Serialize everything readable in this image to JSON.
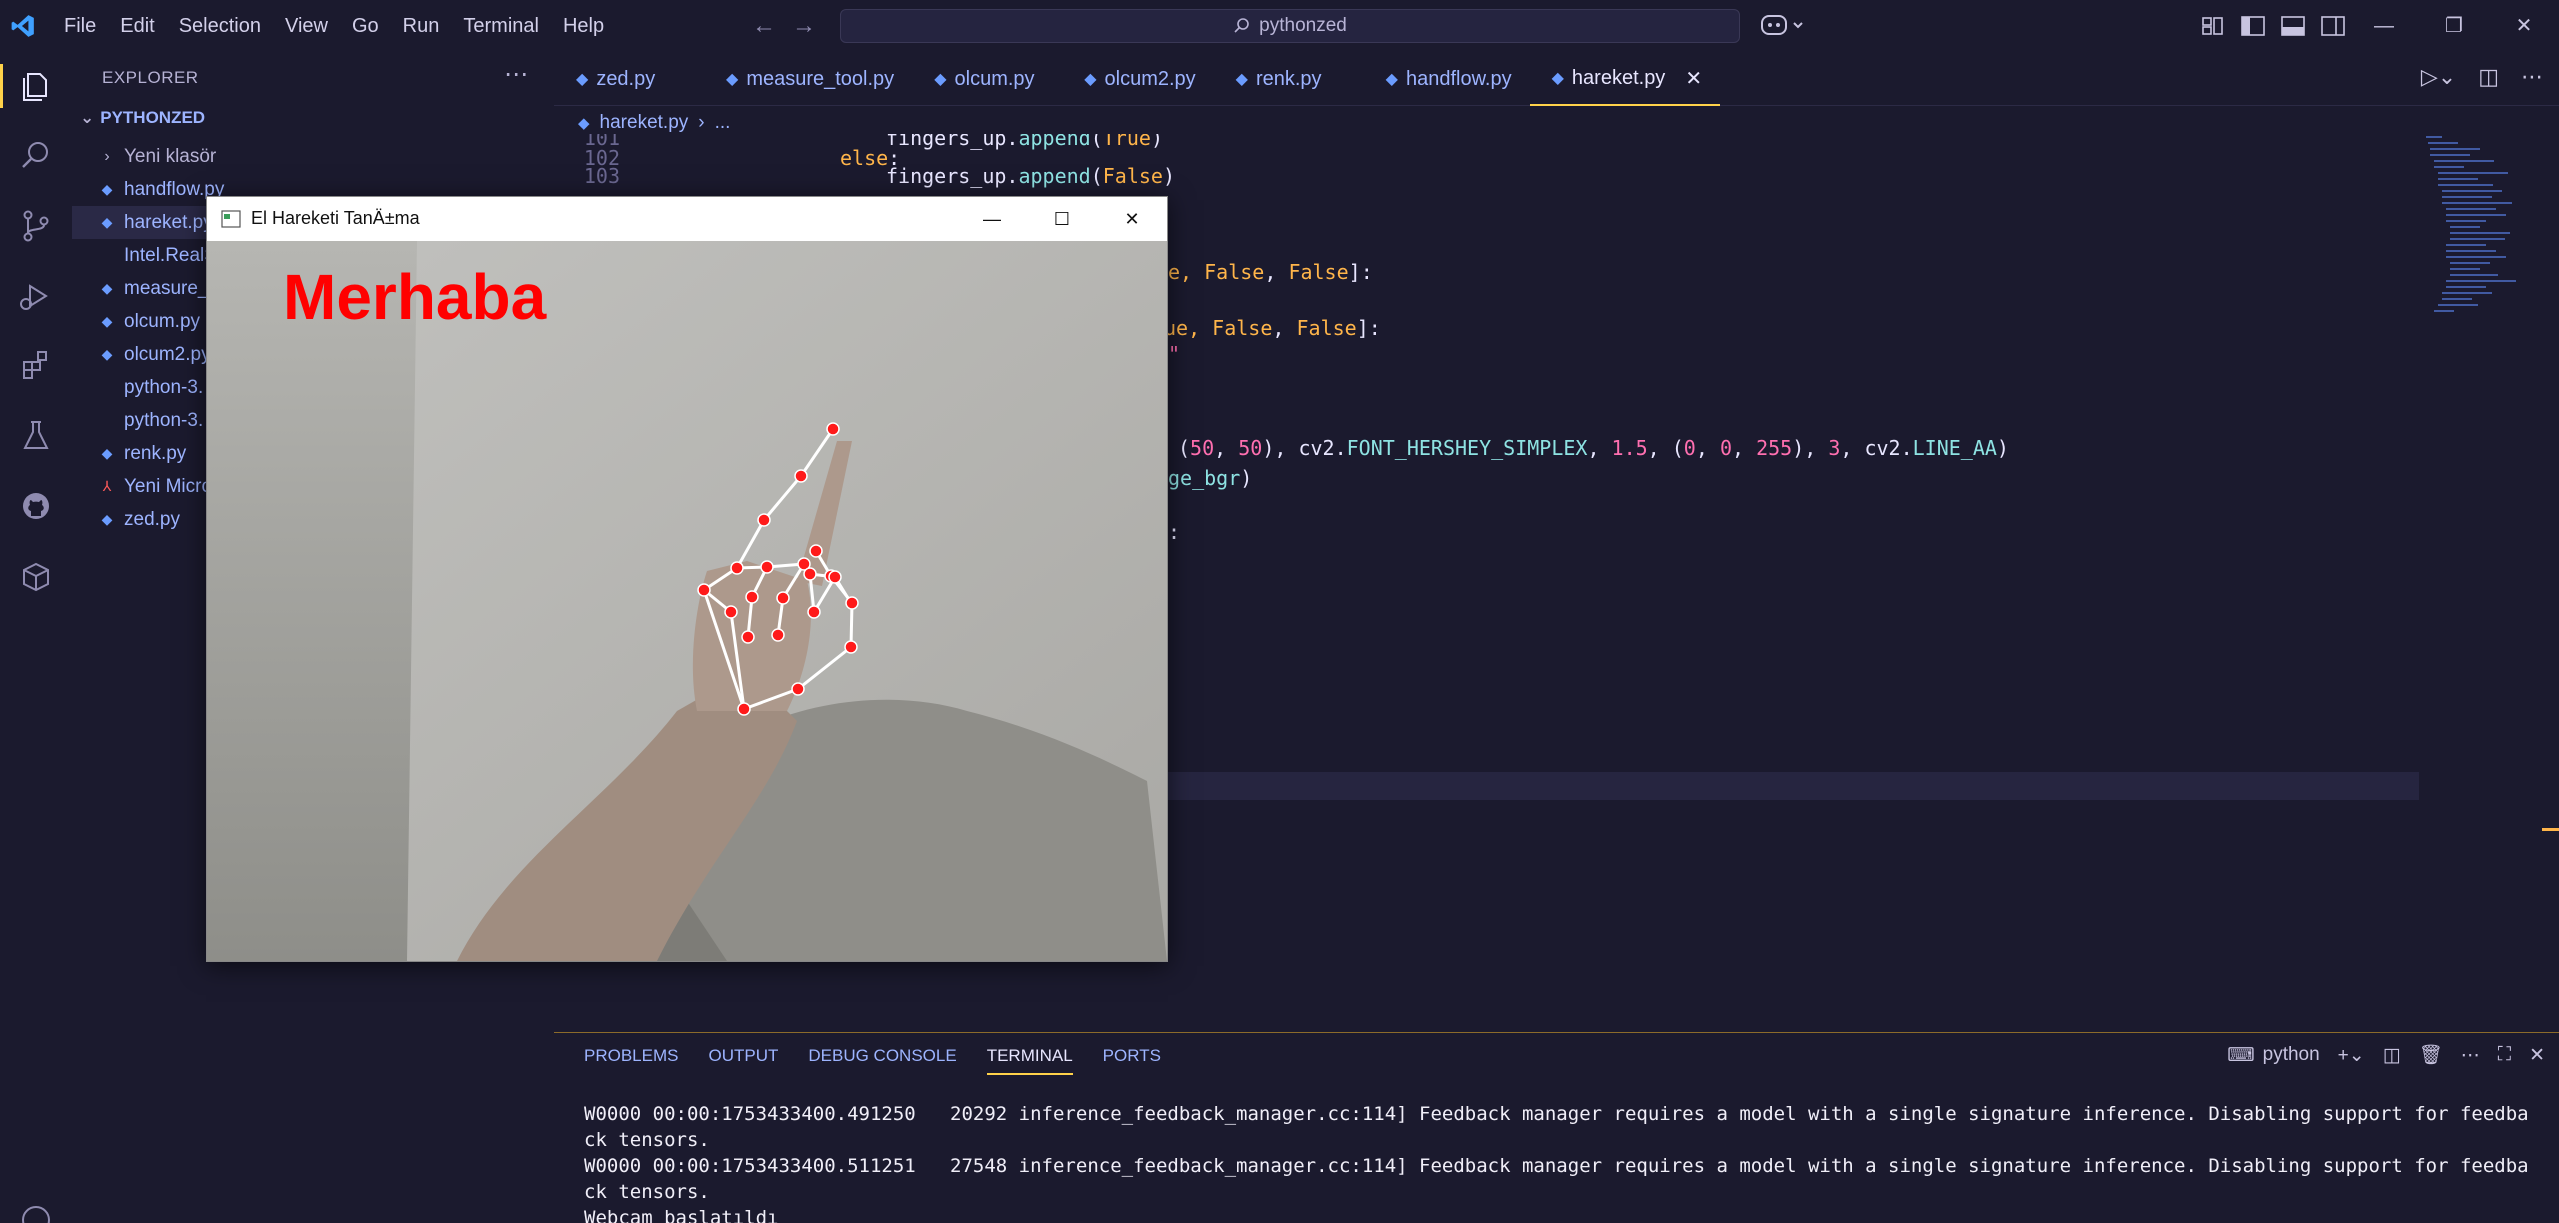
{
  "app": {
    "menu": [
      "File",
      "Edit",
      "Selection",
      "View",
      "Go",
      "Run",
      "Terminal",
      "Help"
    ],
    "search_text": "pythonzed",
    "window_controls": [
      "minimize",
      "restore",
      "close"
    ]
  },
  "sidebar": {
    "title": "EXPLORER",
    "root": "PYTHONZED",
    "items": [
      {
        "label": "Yeni klasör",
        "type": "folder"
      },
      {
        "label": "handflow.py",
        "type": "py"
      },
      {
        "label": "hareket.py",
        "type": "py",
        "active": true
      },
      {
        "label": "Intel.RealSense",
        "type": "text"
      },
      {
        "label": "measure_tool.py",
        "type": "py"
      },
      {
        "label": "olcum.py",
        "type": "py"
      },
      {
        "label": "olcum2.py",
        "type": "py"
      },
      {
        "label": "python-3.",
        "type": "text"
      },
      {
        "label": "python-3.",
        "type": "text"
      },
      {
        "label": "renk.py",
        "type": "py"
      },
      {
        "label": "Yeni Microsoft",
        "type": "pdf"
      },
      {
        "label": "zed.py",
        "type": "py"
      }
    ]
  },
  "editor": {
    "tabs": [
      "zed.py",
      "measure_tool.py",
      "olcum.py",
      "olcum2.py",
      "renk.py",
      "handflow.py",
      "hareket.py"
    ],
    "active_tab": "hareket.py",
    "breadcrumb": [
      "hareket.py",
      "..."
    ],
    "line_numbers": [
      "101",
      "102",
      "103"
    ],
    "code": {
      "l101_ident": "fingers_up",
      "l101_dot": ".",
      "l101_fn": "append",
      "l101_open": "(",
      "l101_val": "True",
      "l101_close": ")",
      "l102_kw": "else",
      "l102_colon": ":",
      "l103_ident": "fingers_up",
      "l103_dot": ".",
      "l103_fn": "append",
      "l103_open": "(",
      "l103_val": "False",
      "l103_close": ")",
      "line_a_pre": "e, ",
      "line_a_v1": "False",
      "line_a_sep": ", ",
      "line_a_v2": "False",
      "line_a_post": "]:",
      "line_b_pre": "ue, ",
      "line_b_v1": "False",
      "line_b_sep": ", ",
      "line_b_v2": "False",
      "line_b_post": "]:",
      "line_c": "\"",
      "line_d_p1": "(",
      "line_d_n1": "50",
      "line_d_p2": ", ",
      "line_d_n2": "50",
      "line_d_p3": "), cv2.",
      "line_d_a1": "FONT_HERSHEY_SIMPLEX",
      "line_d_p4": ", ",
      "line_d_n3": "1.5",
      "line_d_p5": ", (",
      "line_d_n4": "0",
      "line_d_p6": ", ",
      "line_d_n5": "0",
      "line_d_p7": ", ",
      "line_d_n6": "255",
      "line_d_p8": "), ",
      "line_d_n7": "3",
      "line_d_p9": ", cv2.",
      "line_d_a2": "LINE_AA",
      "line_d_p10": ")",
      "line_e_a": "ge_bgr",
      "line_e_p": ")",
      "line_f": ":"
    }
  },
  "panel": {
    "tabs": [
      "PROBLEMS",
      "OUTPUT",
      "DEBUG CONSOLE",
      "TERMINAL",
      "PORTS"
    ],
    "active_tab": "TERMINAL",
    "terminal_profile": "python",
    "lines": [
      "W0000 00:00:1753433400.491250   20292 inference_feedback_manager.cc:114] Feedback manager requires a model with a single signature inference. Disabling support for feedback tensors.",
      "W0000 00:00:1753433400.511251   27548 inference_feedback_manager.cc:114] Feedback manager requires a model with a single signature inference. Disabling support for feedback tensors.",
      "Webcam başlatıldı"
    ]
  },
  "cv_window": {
    "title": "El Hareketi TanÄ±ma",
    "overlay_text": "Merhaba",
    "overlay_color": "#ff0000"
  },
  "colors": {
    "accent": "#ffd24a",
    "file_blue": "#9db4ff",
    "keyword": "#ffb54a",
    "string_num": "#ff6fb0"
  }
}
